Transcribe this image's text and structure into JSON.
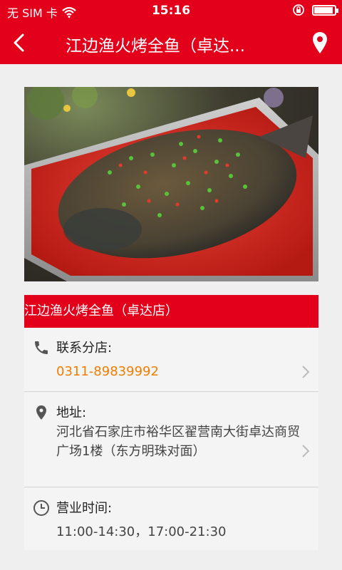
{
  "status_bar": {
    "carrier": "无 SIM 卡",
    "time": "15:16",
    "battery_level": 0.9
  },
  "nav": {
    "title": "江边渔火烤全鱼（卓达...",
    "back_icon": "chevron-left-icon",
    "location_icon": "map-pin-icon"
  },
  "restaurant": {
    "name": "江边渔火烤全鱼（卓达店）",
    "photo_description": "grilled-fish-dish-photo"
  },
  "contact": {
    "label": "联系分店:",
    "phone": "0311-89839992",
    "icon": "phone-icon"
  },
  "address": {
    "label": "地址:",
    "value": "河北省石家庄市裕华区翟营南大街卓达商贸广场1楼（东方明珠对面）",
    "icon": "location-icon"
  },
  "hours": {
    "label": "营业时间:",
    "value": "11:00-14:30，17:00-21:30",
    "icon": "clock-icon"
  },
  "colors": {
    "brand": "#e2001a",
    "phone": "#f07d00",
    "background": "#efefef"
  }
}
